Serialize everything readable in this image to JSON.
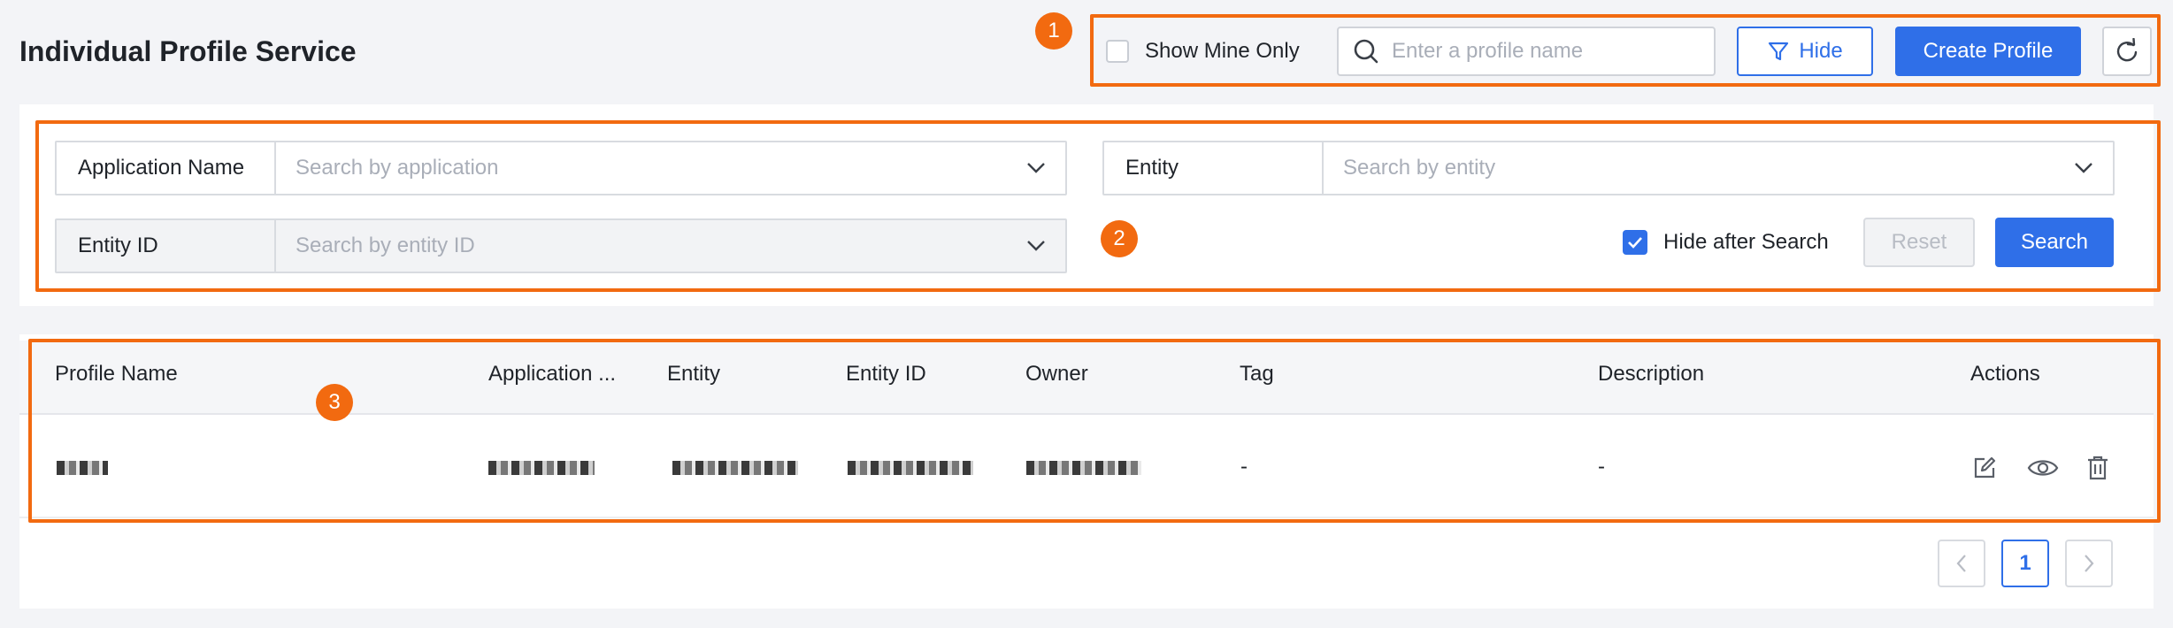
{
  "header": {
    "title": "Individual Profile Service",
    "show_mine_label": "Show Mine Only",
    "search_placeholder": "Enter a profile name",
    "hide_label": "Hide",
    "create_label": "Create Profile"
  },
  "filters": {
    "application": {
      "label": "Application Name",
      "placeholder": "Search by application"
    },
    "entity": {
      "label": "Entity",
      "placeholder": "Search by entity"
    },
    "entity_id": {
      "label": "Entity ID",
      "placeholder": "Search by entity ID"
    },
    "hide_after_search": "Hide after Search",
    "reset_label": "Reset",
    "search_label": "Search"
  },
  "table": {
    "columns": [
      "Profile Name",
      "Application ...",
      "Entity",
      "Entity ID",
      "Owner",
      "Tag",
      "Description",
      "Actions"
    ],
    "rows": [
      {
        "tag": "-",
        "description": "-"
      }
    ]
  },
  "pagination": {
    "current": "1"
  },
  "annotations": [
    "1",
    "2",
    "3"
  ],
  "colors": {
    "primary": "#2f6fe8",
    "annotation": "#f26a10"
  }
}
